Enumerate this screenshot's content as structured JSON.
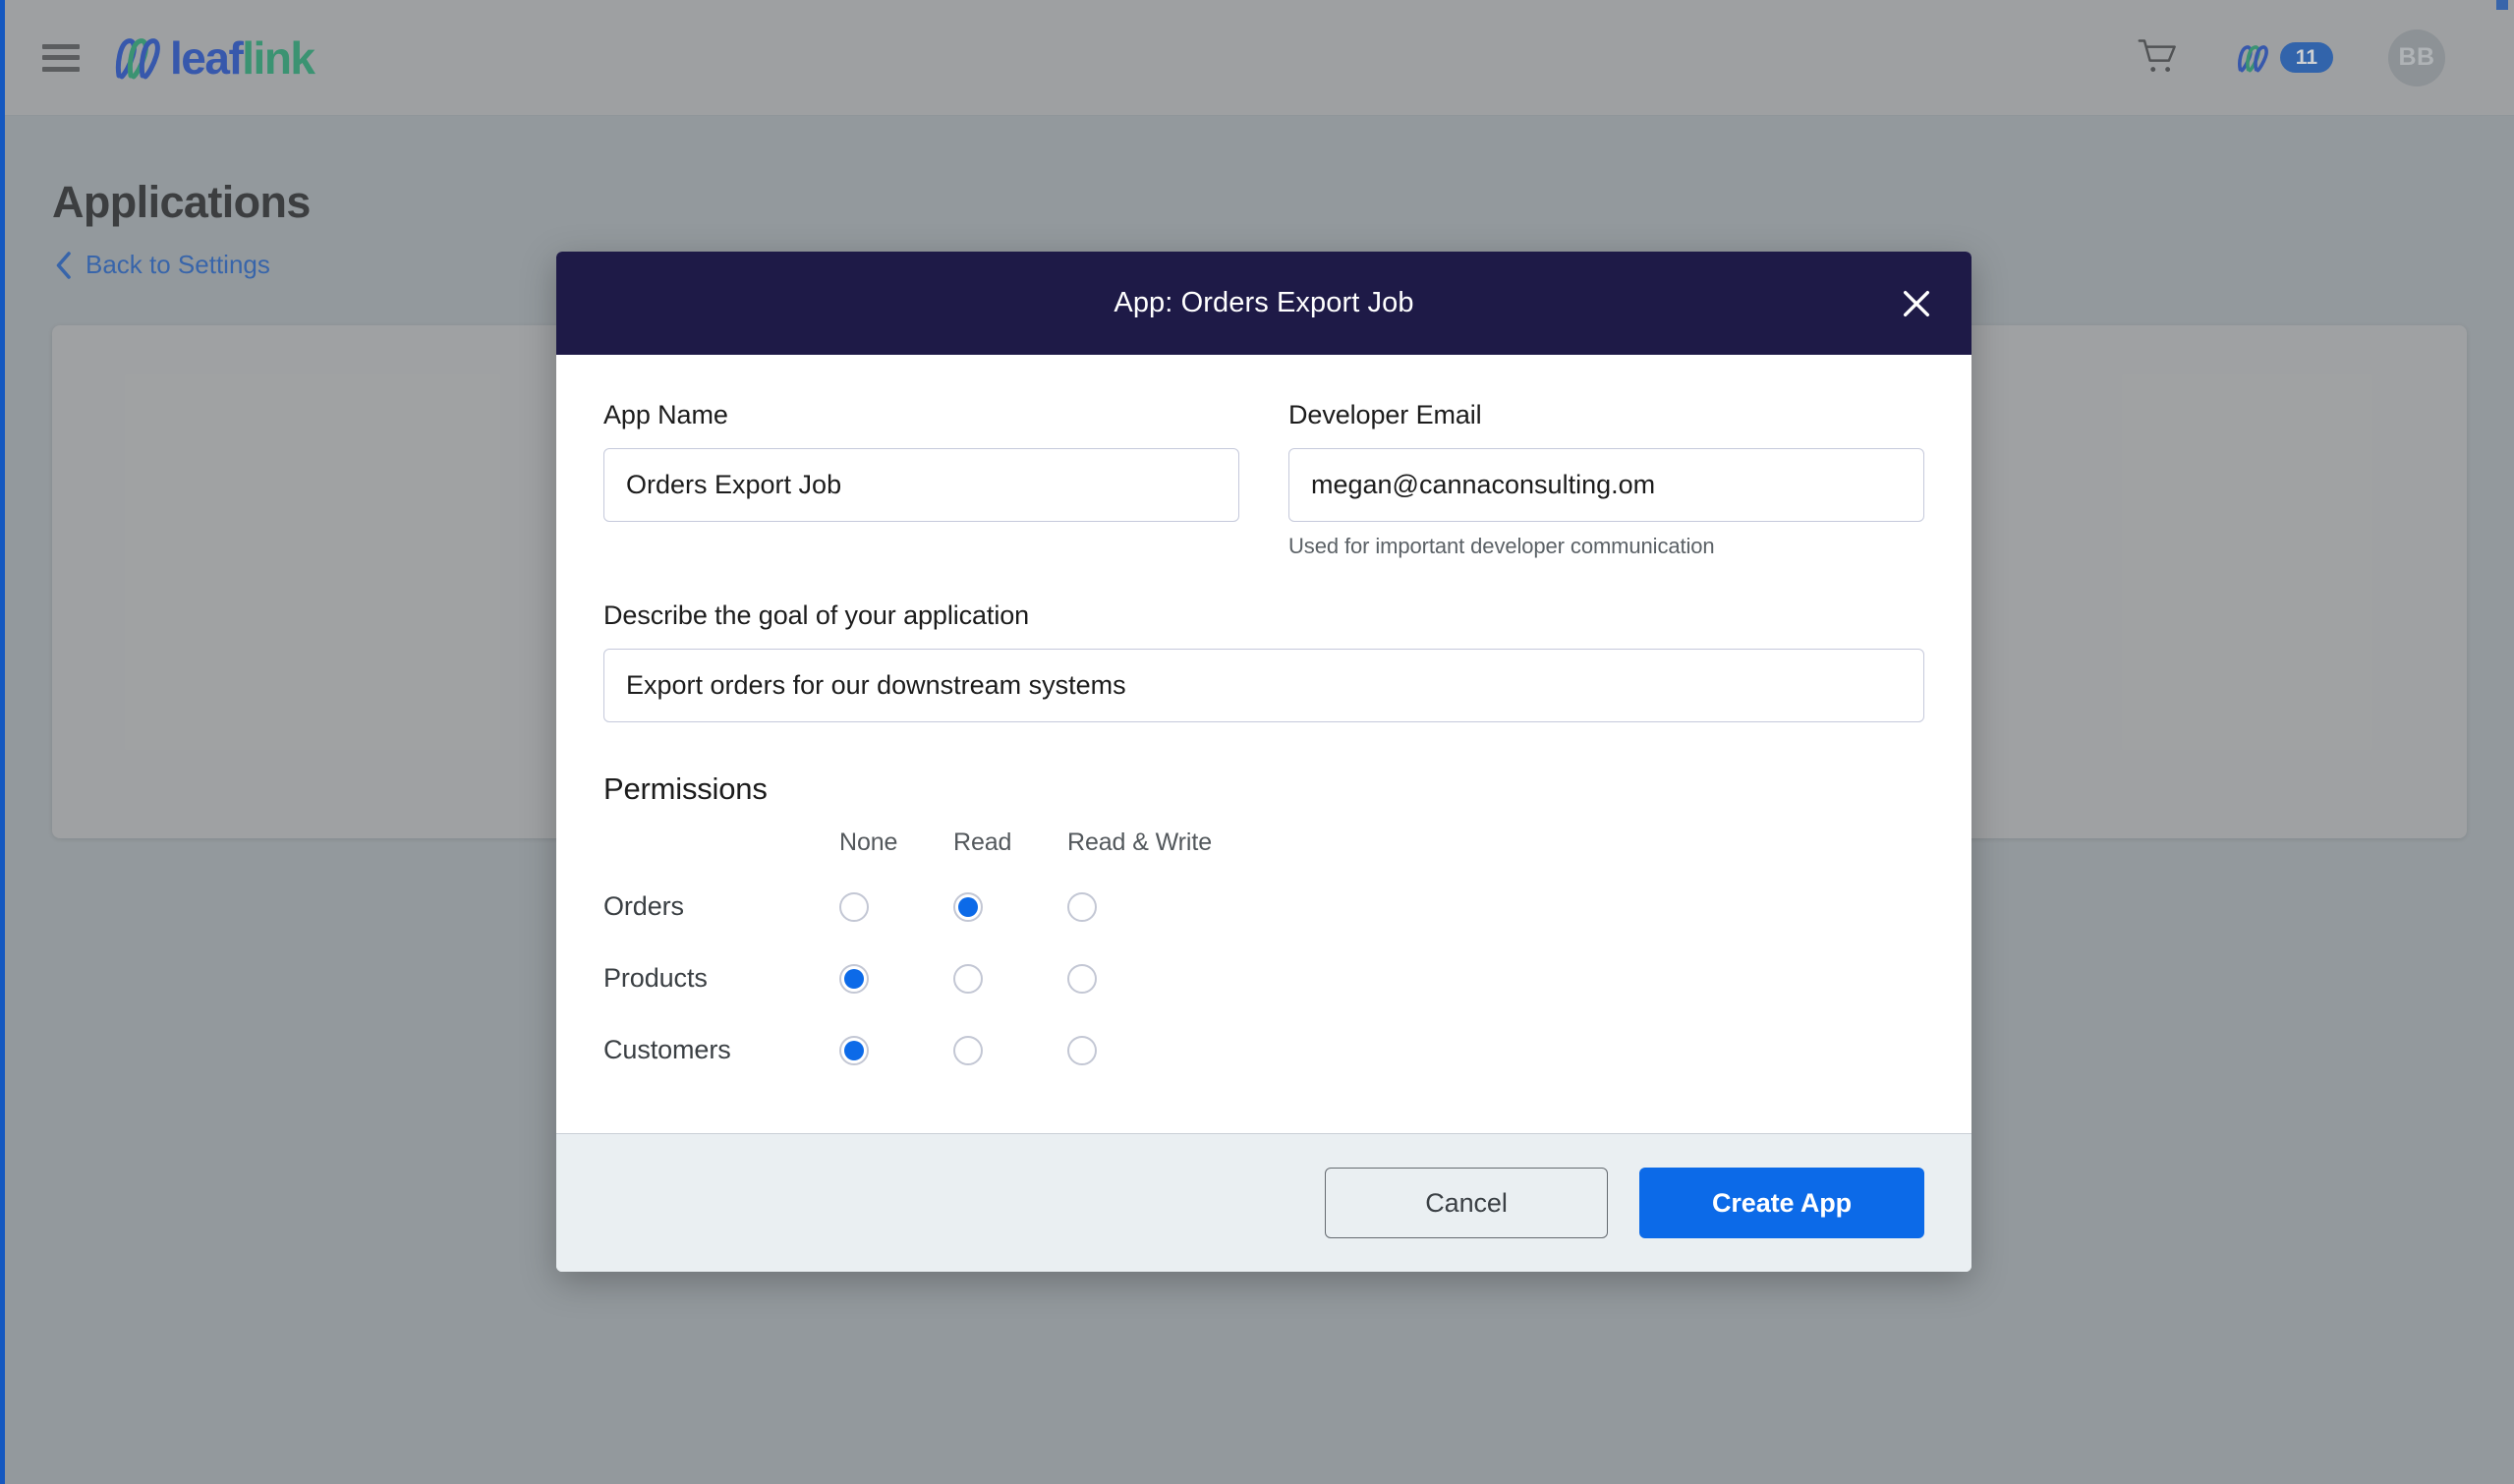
{
  "topbar": {
    "menu_icon": "hamburger-menu-icon",
    "logo": {
      "part1": "leaf",
      "part2": "link"
    },
    "cart_icon": "shopping-cart-icon",
    "notifications": {
      "icon": "leaflink-mark-icon",
      "count": "11"
    },
    "avatar_initials": "BB"
  },
  "page": {
    "title": "Applications",
    "back_link": {
      "icon": "chevron-left-icon",
      "label": "Back to Settings"
    }
  },
  "modal": {
    "title": "App: Orders Export Job",
    "close_icon": "close-x-icon",
    "app_name": {
      "label": "App Name",
      "value": "Orders Export Job",
      "placeholder": "App Name"
    },
    "developer_email": {
      "label": "Developer Email",
      "value": "megan@cannaconsulting.om",
      "placeholder": "Developer Email",
      "help": "Used for important developer communication"
    },
    "description": {
      "label": "Describe the goal of your application",
      "value": "Export orders for our downstream systems",
      "placeholder": "Describe the goal of your application"
    },
    "permissions": {
      "title": "Permissions",
      "columns": [
        "None",
        "Read",
        "Read & Write"
      ],
      "rows": [
        {
          "scope": "Orders",
          "selected": "Read"
        },
        {
          "scope": "Products",
          "selected": "None"
        },
        {
          "scope": "Customers",
          "selected": "None"
        }
      ]
    },
    "footer": {
      "cancel_label": "Cancel",
      "create_label": "Create App"
    }
  },
  "colors": {
    "brand_blue": "#1344c4",
    "brand_green": "#1aa06a",
    "accent_blue": "#0c6ae8",
    "link_blue": "#1558c0",
    "modal_header": "#1e1a47",
    "footer_bg": "#eaeff2"
  }
}
